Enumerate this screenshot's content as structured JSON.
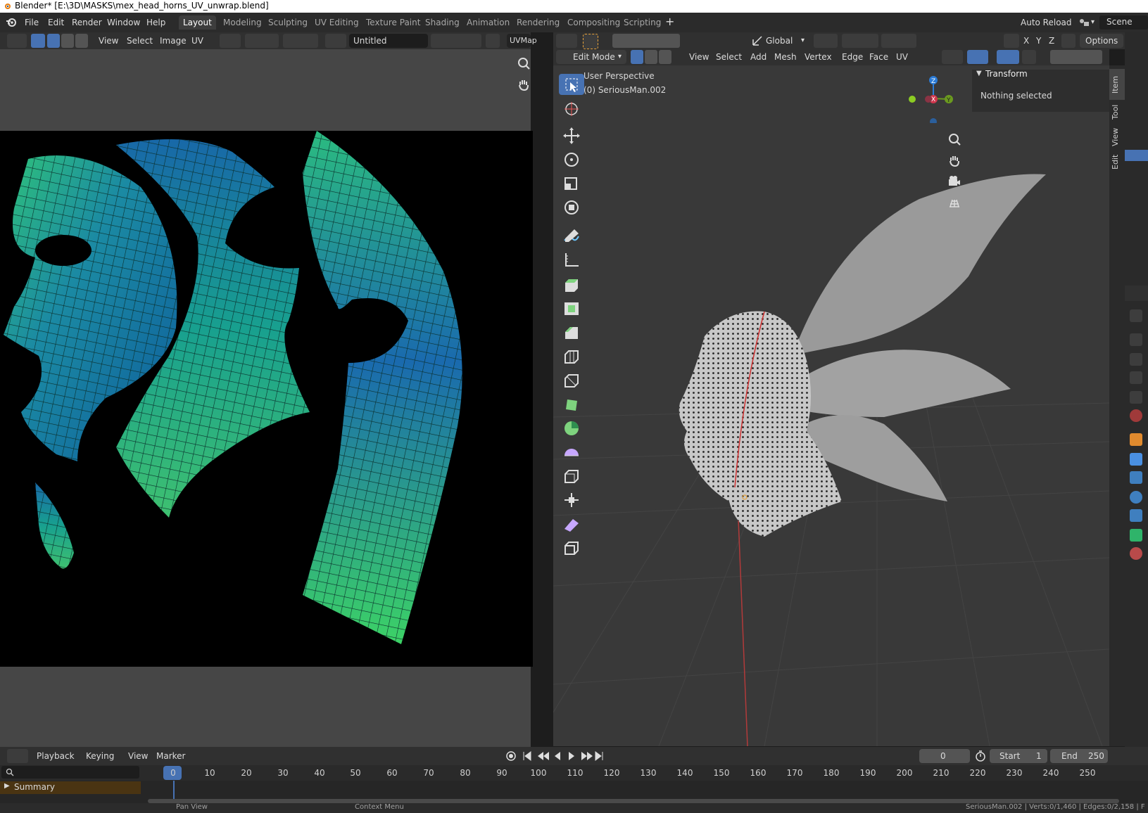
{
  "window": {
    "title": "Blender* [E:\\3D\\MASKS\\mex_head_horns_UV_unwrap.blend]"
  },
  "menu": {
    "items": [
      "File",
      "Edit",
      "Render",
      "Window",
      "Help"
    ]
  },
  "workspaces": {
    "tabs": [
      "Layout",
      "Modeling",
      "Sculpting",
      "UV Editing",
      "Texture Paint",
      "Shading",
      "Animation",
      "Rendering",
      "Compositing",
      "Scripting"
    ],
    "active": "Layout"
  },
  "top_right": {
    "auto_reload": "Auto Reload",
    "scene": "Scene"
  },
  "uv_editor": {
    "menus": [
      "View",
      "Select",
      "Image",
      "UV"
    ],
    "image_name": "Untitled",
    "uvmap": "UVMap"
  },
  "viewport": {
    "orientation": "Global",
    "options": "Options",
    "mode": "Edit Mode",
    "menus": [
      "View",
      "Select",
      "Add",
      "Mesh",
      "Vertex",
      "Edge",
      "Face",
      "UV"
    ],
    "overlay_title": "User Perspective",
    "overlay_object": "(0) SeriousMan.002",
    "gizmo_axes": [
      "Z",
      "X",
      "Y"
    ],
    "xyz": [
      "X",
      "Y",
      "Z"
    ]
  },
  "npanel": {
    "section": "Transform",
    "message": "Nothing selected",
    "tabs": [
      "Item",
      "Tool",
      "View",
      "Edit"
    ]
  },
  "timeline": {
    "menus": [
      "Playback",
      "Keying",
      "View",
      "Marker"
    ],
    "current_frame": "0",
    "start_label": "Start",
    "start_value": "1",
    "end_label": "End",
    "end_value": "250",
    "ruler": [
      "0",
      "10",
      "20",
      "30",
      "40",
      "50",
      "60",
      "70",
      "80",
      "90",
      "100",
      "110",
      "120",
      "130",
      "140",
      "150",
      "160",
      "170",
      "180",
      "190",
      "200",
      "210",
      "220",
      "230",
      "240",
      "250"
    ],
    "summary": "Summary"
  },
  "status": {
    "left": "Pan View",
    "mid": "Context Menu",
    "right": "SeriousMan.002 | Verts:0/1,460 | Edges:0/2,158 | F"
  }
}
